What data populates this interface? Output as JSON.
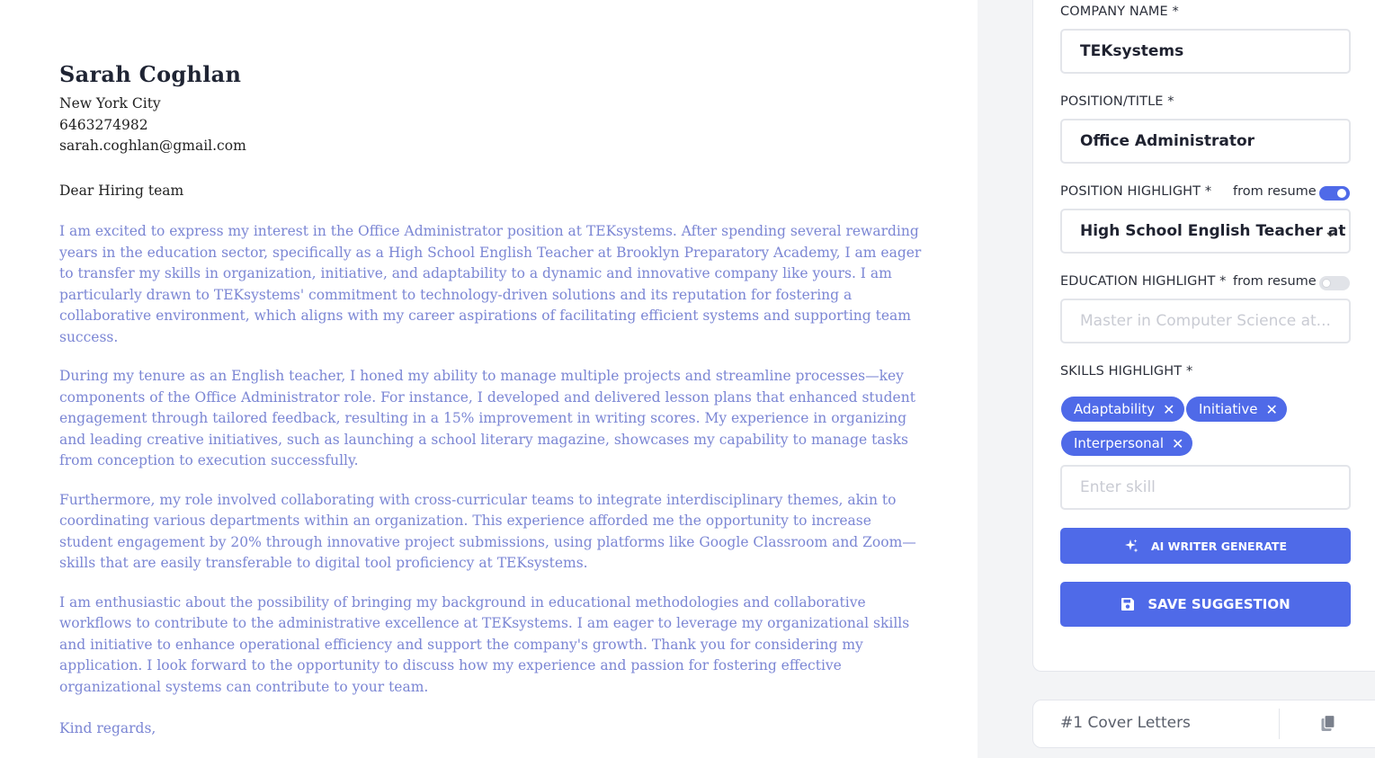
{
  "letter": {
    "name": "Sarah Coghlan",
    "city": "New York City",
    "phone": "6463274982",
    "email": "sarah.coghlan@gmail.com",
    "salutation": "Dear Hiring team",
    "paragraphs": [
      "I am excited to express my interest in the Office Administrator position at TEKsystems. After spending several rewarding years in the education sector, specifically as a High School English Teacher at Brooklyn Preparatory Academy, I am eager to transfer my skills in organization, initiative, and adaptability to a dynamic and innovative company like yours. I am particularly drawn to TEKsystems' commitment to technology-driven solutions and its reputation for fostering a collaborative environment, which aligns with my career aspirations of facilitating efficient systems and supporting team success.",
      "During my tenure as an English teacher, I honed my ability to manage multiple projects and streamline processes—key components of the Office Administrator role. For instance, I developed and delivered lesson plans that enhanced student engagement through tailored feedback, resulting in a 15% improvement in writing scores. My experience in organizing and leading creative initiatives, such as launching a school literary magazine, showcases my capability to manage tasks from conception to execution successfully.",
      "Furthermore, my role involved collaborating with cross-curricular teams to integrate interdisciplinary themes, akin to coordinating various departments within an organization. This experience afforded me the opportunity to increase student engagement by 20% through innovative project submissions, using platforms like Google Classroom and Zoom—skills that are easily transferable to digital tool proficiency at TEKsystems.",
      "I am enthusiastic about the possibility of bringing my background in educational methodologies and collaborative workflows to contribute to the administrative excellence at TEKsystems. I am eager to leverage my organizational skills and initiative to enhance operational efficiency and support the company's growth. Thank you for considering my application. I look forward to the opportunity to discuss how my experience and passion for fostering effective organizational systems can contribute to your team."
    ],
    "closing": "Kind regards,"
  },
  "form": {
    "company_label": "COMPANY NAME *",
    "company_value": "TEKsystems",
    "position_label": "POSITION/TITLE *",
    "position_value": "Office Administrator",
    "position_highlight_label": "POSITION HIGHLIGHT *",
    "position_highlight_toggle_label": "from resume",
    "position_highlight_toggle_on": true,
    "position_highlight_value": "High School English Teacher at B",
    "education_highlight_label": "EDUCATION HIGHLIGHT *",
    "education_highlight_toggle_label": "from resume",
    "education_highlight_toggle_on": false,
    "education_highlight_placeholder": "Master in Computer Science at...",
    "skills_label": "SKILLS HIGHLIGHT *",
    "skills": [
      "Adaptability",
      "Initiative",
      "Interpersonal"
    ],
    "skill_remove_glyph": "✕",
    "skill_placeholder": "Enter skill",
    "ai_button_label": "AI WRITER GENERATE",
    "save_button_label": "SAVE SUGGESTION"
  },
  "cover_letters": {
    "title": "#1 Cover Letters"
  },
  "icons": {
    "ai": "sparkle-icon",
    "save": "floppy-disk-icon",
    "copy": "copy-icon",
    "remove": "close-icon"
  },
  "colors": {
    "accent": "#4f6ae8",
    "letter_body": "#7b86d4",
    "panel_bg": "#f3f4f6"
  }
}
